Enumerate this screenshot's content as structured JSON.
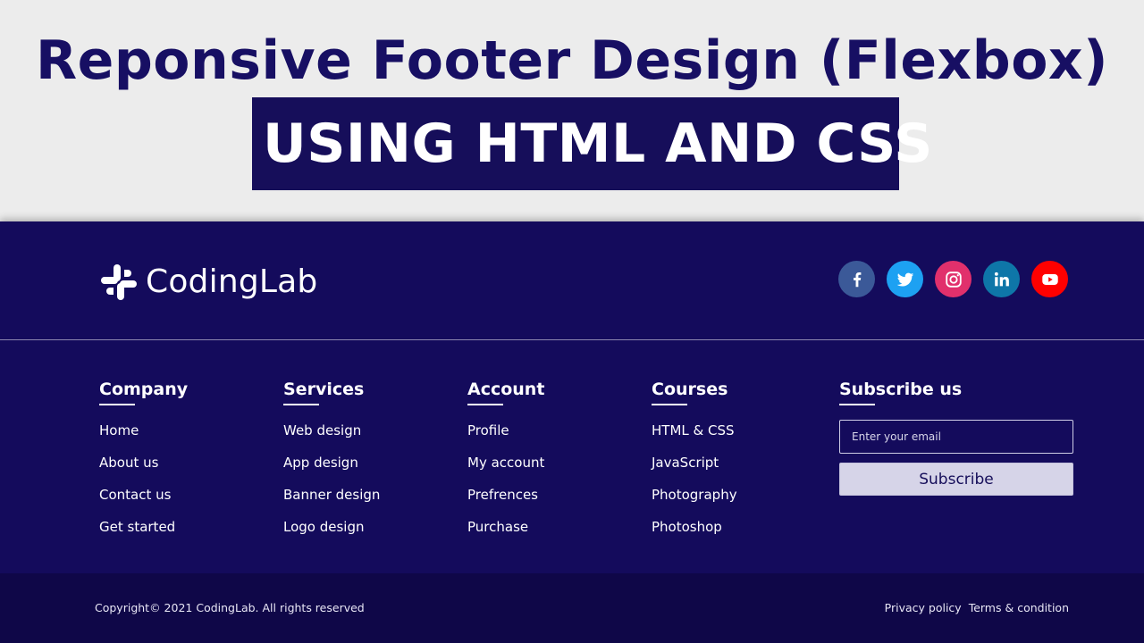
{
  "banner": {
    "headline": "Reponsive Footer Design (Flexbox)",
    "subline": "USING HTML AND CSS"
  },
  "brand": {
    "name": "CodingLab",
    "icon": "slack-logo-icon"
  },
  "social": [
    {
      "icon": "facebook-icon",
      "color": "#3b5998"
    },
    {
      "icon": "twitter-icon",
      "color": "#1da1f2"
    },
    {
      "icon": "instagram-icon",
      "color": "#e1306c"
    },
    {
      "icon": "linkedin-icon",
      "color": "#0e76a8"
    },
    {
      "icon": "youtube-icon",
      "color": "#ff0000"
    }
  ],
  "columns": [
    {
      "title": "Company",
      "links": [
        "Home",
        "About us",
        "Contact us",
        "Get started"
      ]
    },
    {
      "title": "Services",
      "links": [
        "Web design",
        "App design",
        "Banner design",
        "Logo design"
      ]
    },
    {
      "title": "Account",
      "links": [
        "Profile",
        "My account",
        "Prefrences",
        "Purchase"
      ]
    },
    {
      "title": "Courses",
      "links": [
        "HTML & CSS",
        "JavaScript",
        "Photography",
        "Photoshop"
      ]
    }
  ],
  "subscribe": {
    "title": "Subscribe us",
    "placeholder": "Enter your email",
    "button_label": "Subscribe"
  },
  "bottom": {
    "copyright": "Copyright© 2021 CodingLab. All rights reserved",
    "links": [
      "Privacy policy",
      "Terms & condition"
    ]
  },
  "colors": {
    "footer_bg": "#140b5c",
    "bottom_bar_bg": "#0f0748",
    "headline": "#170f63"
  }
}
